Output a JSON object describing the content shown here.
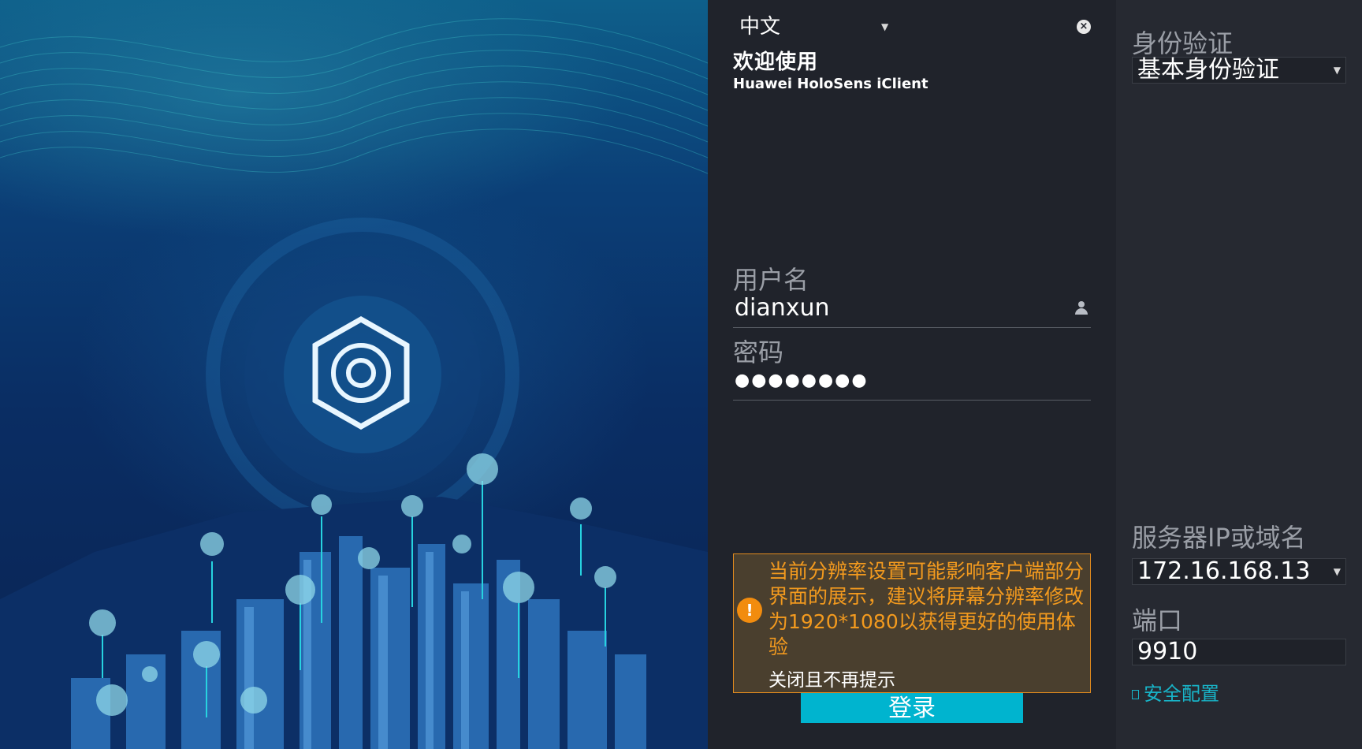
{
  "login": {
    "language": "中文",
    "welcome": "欢迎使用",
    "product": "Huawei HoloSens iClient",
    "username_label": "用户名",
    "username_value": "dianxun",
    "password_label": "密码",
    "password_value": "●●●●●●●●",
    "warning_text": "当前分辨率设置可能影响客户端部分界面的展示，建议将屏幕分辨率修改为1920*1080以获得更好的使用体验",
    "dismiss_label": "关闭且不再提示",
    "login_button": "登录"
  },
  "settings": {
    "auth_label": "身份验证",
    "auth_value": "基本身份验证",
    "server_label": "服务器IP或域名",
    "server_value": "172.16.168.13",
    "port_label": "端口",
    "port_value": "9910",
    "security_link": "安全配置"
  },
  "colors": {
    "accent": "#00b4cf",
    "warning": "#f28c0e",
    "panel": "#20232b",
    "side_panel": "#262931"
  },
  "icons": [
    "logo-hexagon-icon",
    "user-icon",
    "close-icon",
    "chevron-down-icon",
    "warning-icon",
    "document-icon"
  ]
}
